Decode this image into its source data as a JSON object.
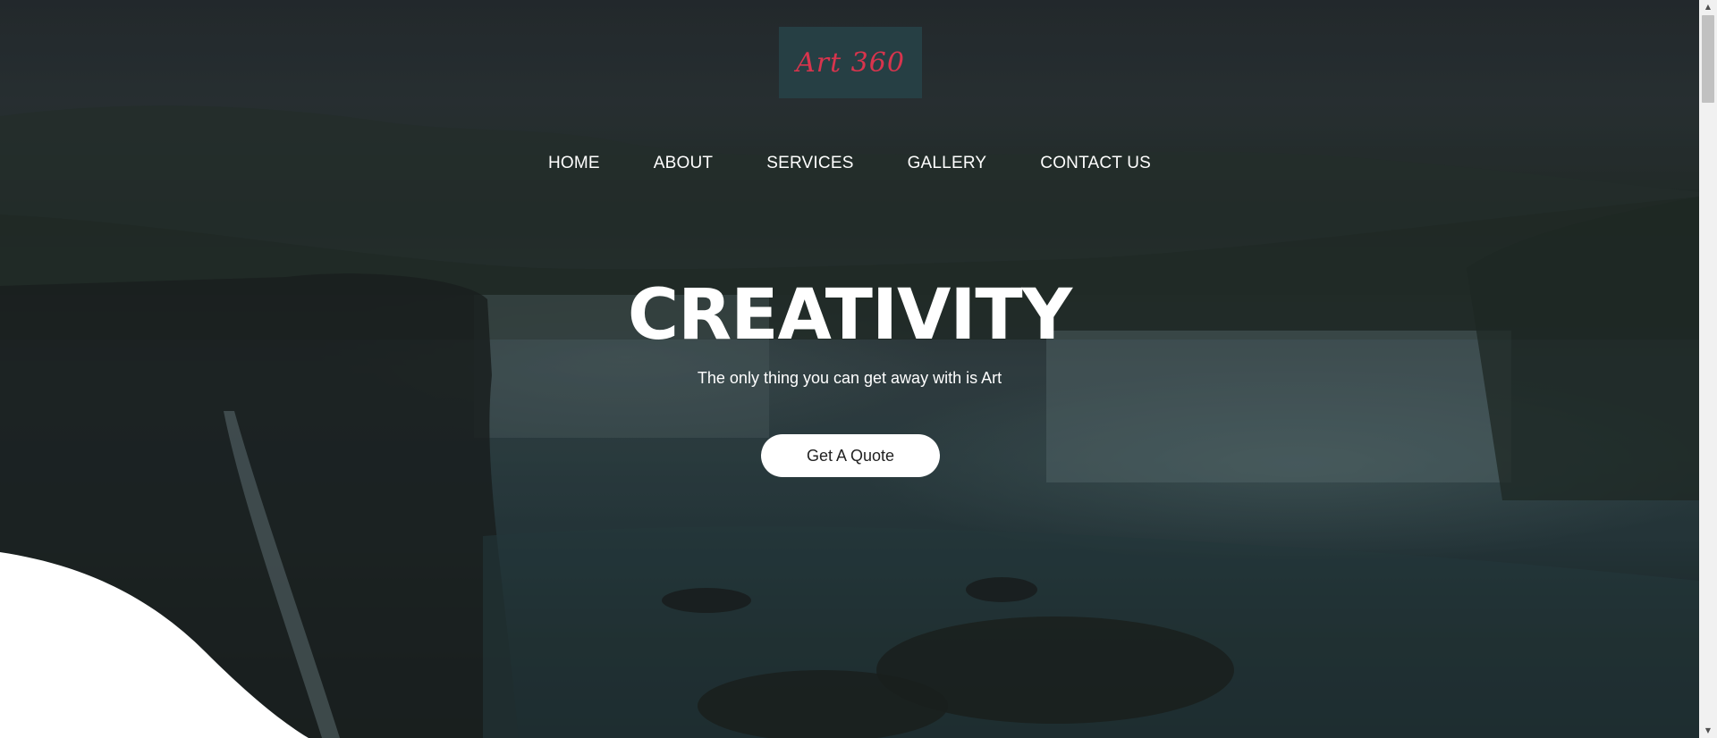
{
  "logo": {
    "text": "Art 360"
  },
  "nav": {
    "items": [
      {
        "label": "HOME"
      },
      {
        "label": "ABOUT"
      },
      {
        "label": "SERVICES"
      },
      {
        "label": "GALLERY"
      },
      {
        "label": "CONTACT US"
      }
    ]
  },
  "hero": {
    "headline": "CREATIVITY",
    "tagline": "The only thing you can get away with is Art",
    "cta_label": "Get A Quote"
  },
  "scrollbar": {
    "up_icon": "triangle-up-icon",
    "down_icon": "triangle-down-icon"
  },
  "colors": {
    "logo_bg": "#263f44",
    "logo_text": "#d8344d",
    "cta_bg": "#ffffff",
    "text": "#ffffff"
  }
}
